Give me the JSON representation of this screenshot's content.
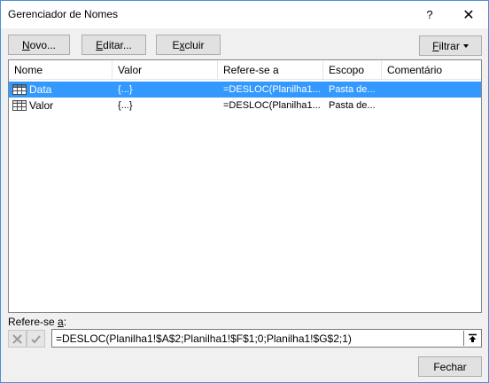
{
  "window": {
    "title": "Gerenciador de Nomes",
    "help_label": "?",
    "close_label": "✕"
  },
  "toolbar": {
    "new_pre": "",
    "new_ul": "N",
    "new_post": "ovo...",
    "edit_pre": "",
    "edit_ul": "E",
    "edit_post": "ditar...",
    "delete_pre": "E",
    "delete_ul": "x",
    "delete_post": "cluir",
    "filter_pre": "",
    "filter_ul": "F",
    "filter_post": "iltrar"
  },
  "table": {
    "columns": [
      "Nome",
      "Valor",
      "Refere-se a",
      "Escopo",
      "Comentário"
    ],
    "rows": [
      {
        "name": "Data",
        "value": "{...}",
        "refers": "=DESLOC(Planilha1...",
        "scope": "Pasta de...",
        "comment": "",
        "selected": true
      },
      {
        "name": "Valor",
        "value": "{...}",
        "refers": "=DESLOC(Planilha1...",
        "scope": "Pasta de...",
        "comment": "",
        "selected": false
      }
    ]
  },
  "refers_to": {
    "label_pre": "Refere-se ",
    "label_ul": "a",
    "label_post": ":",
    "value": "=DESLOC(Planilha1!$A$2;Planilha1!$F$1;0;Planilha1!$G$2;1)"
  },
  "footer": {
    "close_label": "Fechar"
  },
  "colors": {
    "selection": "#3399ff",
    "window_border": "#4a90d9",
    "dialog_bg": "#f0f0f0"
  }
}
